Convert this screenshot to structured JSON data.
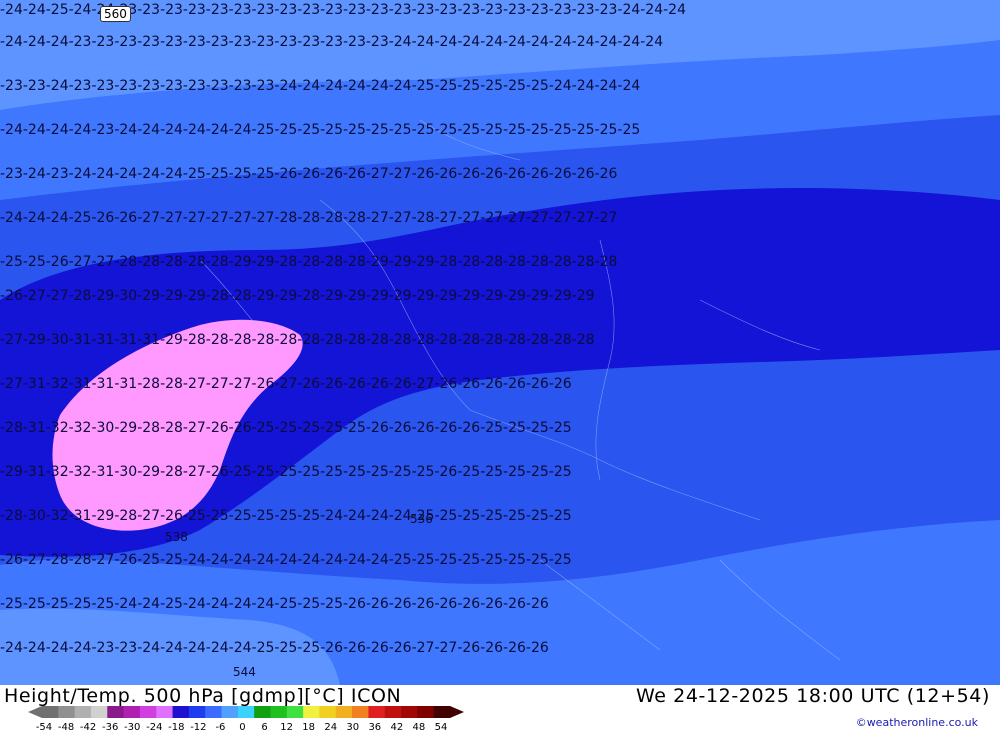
{
  "map": {
    "title": "Height/Temp. 500 hPa [gdmp][°C] ICON",
    "valid_time": "We 24-12-2025 18:00 UTC (12+54)",
    "credit": "©weatheronline.co.uk",
    "height_contours": [
      "560",
      "536",
      "538",
      "544"
    ],
    "temperature_labels": [
      "-23",
      "-24",
      "-25",
      "-26",
      "-27",
      "-28",
      "-29",
      "-30",
      "-31",
      "-32"
    ],
    "colors": {
      "t_minus_23": "#5e94ff",
      "t_minus_24": "#3f78ff",
      "t_minus_26": "#2a55ee",
      "t_minus_28": "#1414d6",
      "t_minus_30": "#ff99ff"
    },
    "color_scale": {
      "ticks": [
        "-54",
        "-48",
        "-42",
        "-36",
        "-30",
        "-24",
        "-18",
        "-12",
        "-6",
        "0",
        "6",
        "12",
        "18",
        "24",
        "30",
        "36",
        "42",
        "48",
        "54"
      ],
      "colors": [
        "#707070",
        "#909090",
        "#b0b0b0",
        "#d0d0d0",
        "#8a1a8a",
        "#b020b0",
        "#d040e0",
        "#e070ff",
        "#2010d0",
        "#1e3cf0",
        "#3c6cff",
        "#50a0ff",
        "#3cd2ff",
        "#10a010",
        "#20c020",
        "#40e040",
        "#f0f040",
        "#f0d020",
        "#f0b020",
        "#f08020",
        "#e02020",
        "#c01010",
        "#a00808",
        "#800000",
        "#400000"
      ]
    }
  }
}
